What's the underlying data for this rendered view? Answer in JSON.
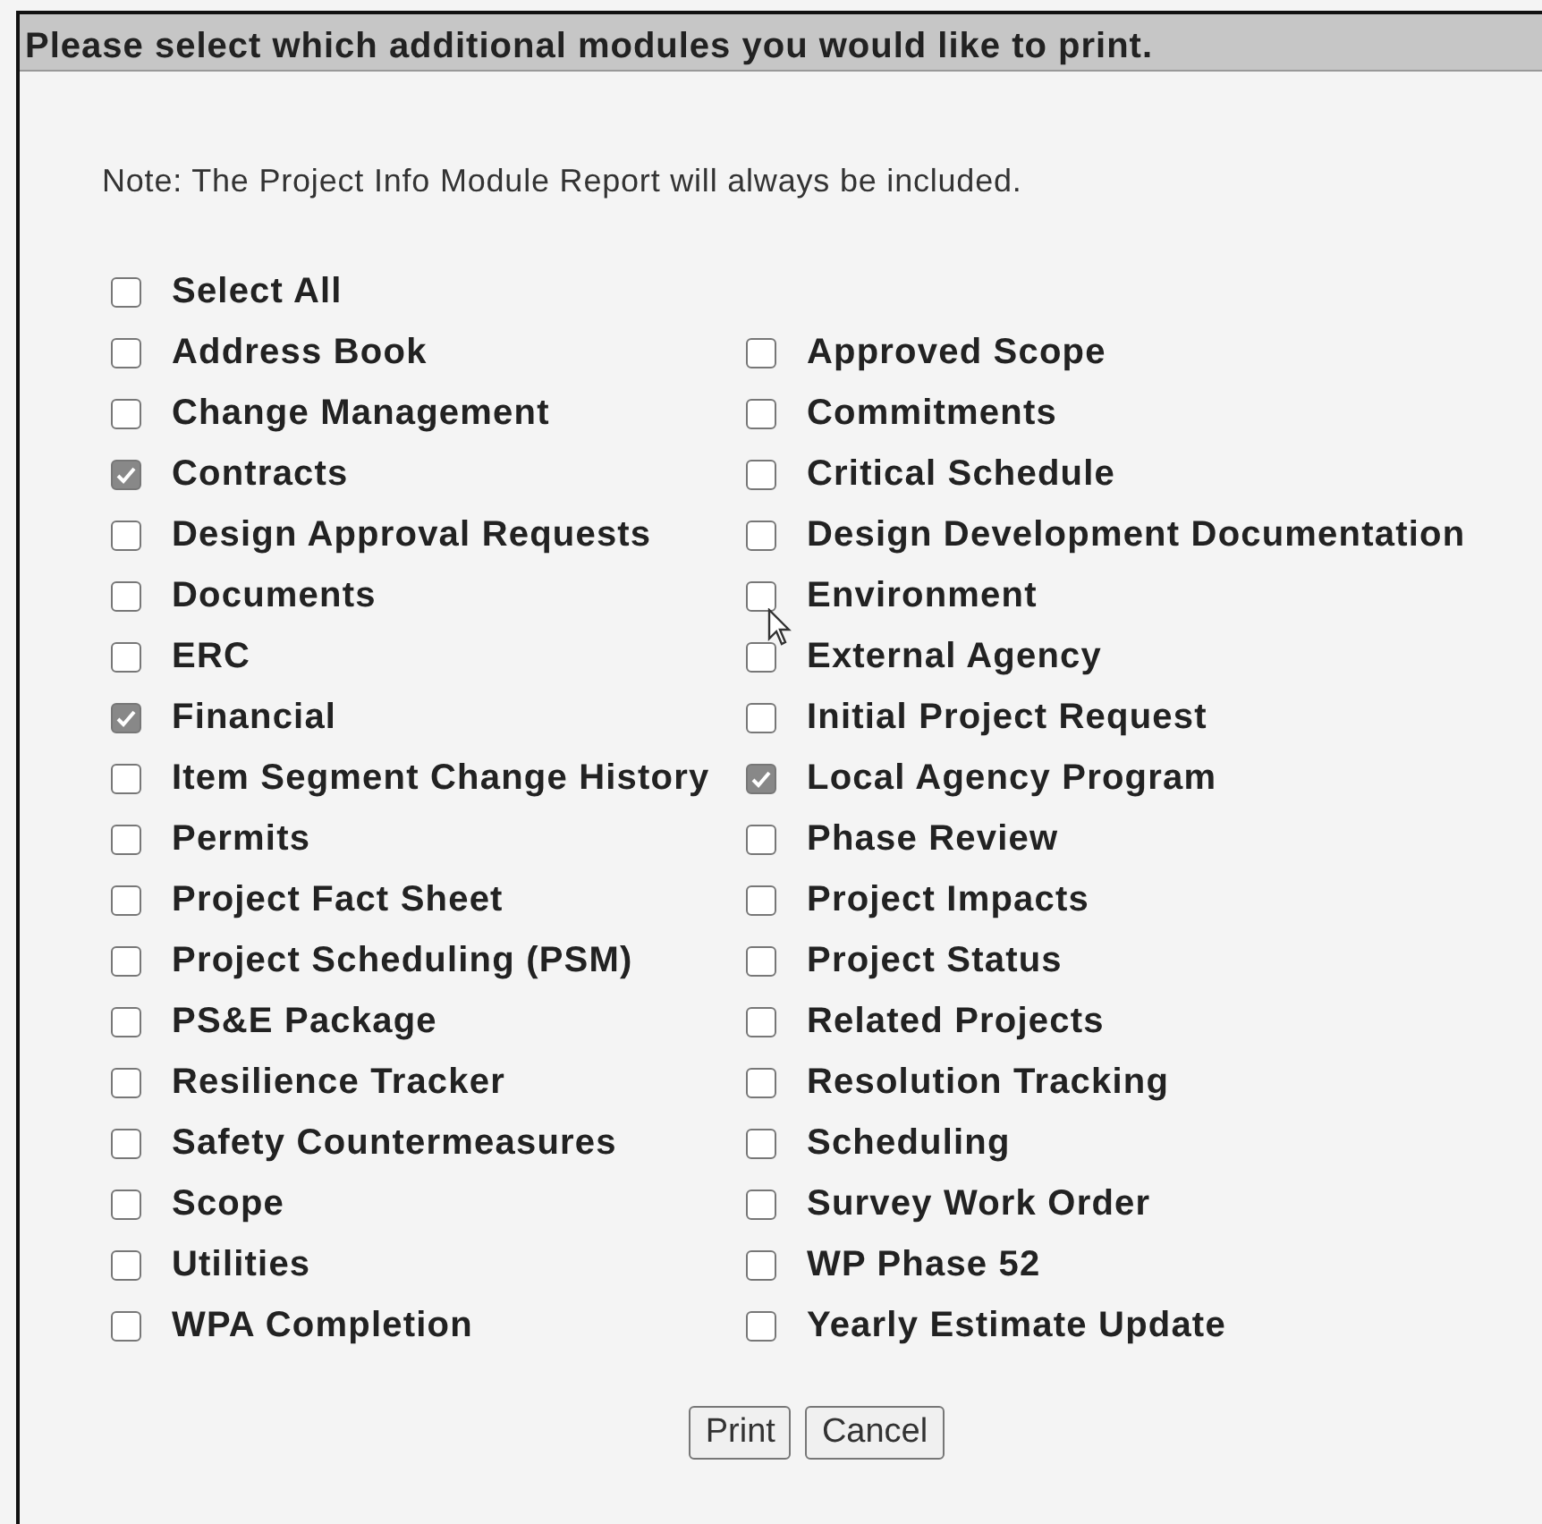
{
  "dialog": {
    "title": "Please select which additional modules you would like to print.",
    "note": "Note: The Project Info Module Report will always be included.",
    "select_all": {
      "label": "Select All",
      "checked": false
    },
    "modules": [
      {
        "label": "Address Book",
        "checked": false
      },
      {
        "label": "Approved Scope",
        "checked": false
      },
      {
        "label": "Change Management",
        "checked": false
      },
      {
        "label": "Commitments",
        "checked": false
      },
      {
        "label": "Contracts",
        "checked": true
      },
      {
        "label": "Critical Schedule",
        "checked": false
      },
      {
        "label": "Design Approval Requests",
        "checked": false
      },
      {
        "label": "Design Development Documentation",
        "checked": false
      },
      {
        "label": "Documents",
        "checked": false
      },
      {
        "label": "Environment",
        "checked": false
      },
      {
        "label": "ERC",
        "checked": false
      },
      {
        "label": "External Agency",
        "checked": false
      },
      {
        "label": "Financial",
        "checked": true
      },
      {
        "label": "Initial Project Request",
        "checked": false
      },
      {
        "label": "Item Segment Change History",
        "checked": false
      },
      {
        "label": "Local Agency Program",
        "checked": true
      },
      {
        "label": "Permits",
        "checked": false
      },
      {
        "label": "Phase Review",
        "checked": false
      },
      {
        "label": "Project Fact Sheet",
        "checked": false
      },
      {
        "label": "Project Impacts",
        "checked": false
      },
      {
        "label": "Project Scheduling (PSM)",
        "checked": false
      },
      {
        "label": "Project Status",
        "checked": false
      },
      {
        "label": "PS&E Package",
        "checked": false
      },
      {
        "label": "Related Projects",
        "checked": false
      },
      {
        "label": "Resilience Tracker",
        "checked": false
      },
      {
        "label": "Resolution Tracking",
        "checked": false
      },
      {
        "label": "Safety Countermeasures",
        "checked": false
      },
      {
        "label": "Scheduling",
        "checked": false
      },
      {
        "label": "Scope",
        "checked": false
      },
      {
        "label": "Survey Work Order",
        "checked": false
      },
      {
        "label": "Utilities",
        "checked": false
      },
      {
        "label": "WP Phase 52",
        "checked": false
      },
      {
        "label": "WPA Completion",
        "checked": false
      },
      {
        "label": "Yearly Estimate Update",
        "checked": false
      }
    ],
    "buttons": [
      "Print",
      "Cancel"
    ]
  }
}
